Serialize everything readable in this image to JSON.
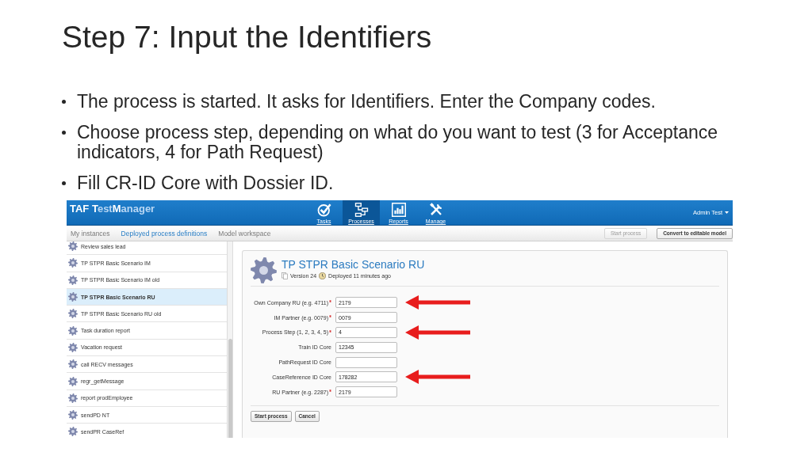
{
  "slide": {
    "title": "Step 7: Input the Identifiers",
    "bullets": [
      "The process is started. It asks for Identifiers. Enter the Company codes.",
      "Choose process step, depending on what do you want to test (3 for Acceptance indicators, 4 for Path Request)",
      "Fill CR-ID Core with Dossier ID."
    ]
  },
  "app": {
    "logo": {
      "segments": [
        {
          "text": "TAF T",
          "strong": true
        },
        {
          "text": "est",
          "strong": false
        },
        {
          "text": "M",
          "strong": true
        },
        {
          "text": "anager",
          "strong": false
        }
      ]
    },
    "nav": [
      {
        "label": "Tasks",
        "selected": false
      },
      {
        "label": "Processes",
        "selected": true
      },
      {
        "label": "Reports",
        "selected": false
      },
      {
        "label": "Manage",
        "selected": false
      }
    ],
    "user_menu": {
      "label": "Admin Test"
    },
    "tabs": [
      {
        "label": "My instances",
        "selected": false
      },
      {
        "label": "Deployed process definitions",
        "selected": true
      },
      {
        "label": "Model workspace",
        "selected": false
      }
    ],
    "toolbar_buttons": [
      {
        "label": "Start process",
        "disabled": true
      },
      {
        "label": "Convert to editable model",
        "disabled": false
      }
    ],
    "sidebar": {
      "items": [
        {
          "label": "Review sales lead",
          "selected": false
        },
        {
          "label": "TP STPR Basic Scenario IM",
          "selected": false
        },
        {
          "label": "TP STPR Basic Scenario IM old",
          "selected": false
        },
        {
          "label": "TP STPR Basic Scenario RU",
          "selected": true
        },
        {
          "label": "TP STPR Basic Scenario RU old",
          "selected": false
        },
        {
          "label": "Task duration report",
          "selected": false
        },
        {
          "label": "Vacation request",
          "selected": false
        },
        {
          "label": "call RECV messages",
          "selected": false
        },
        {
          "label": "regr_getMessage",
          "selected": false
        },
        {
          "label": "report prodEmployee",
          "selected": false
        },
        {
          "label": "sendPD NT",
          "selected": false
        },
        {
          "label": "sendPR CaseRef",
          "selected": false
        }
      ]
    },
    "process": {
      "title": "TP STPR Basic Scenario RU",
      "version": "Version 24",
      "deployed": "Deployed 11 minutes ago",
      "fields": [
        {
          "label": "Own Company RU (e.g. 4711)",
          "required": true,
          "value": "2179",
          "annotated": true
        },
        {
          "label": "IM Partner (e.g. 0079)",
          "required": true,
          "value": "0079",
          "annotated": false
        },
        {
          "label": "Process Step (1, 2, 3, 4, 5)",
          "required": true,
          "value": "4",
          "annotated": true
        },
        {
          "label": "Train ID Core",
          "required": false,
          "value": "12345",
          "annotated": false
        },
        {
          "label": "PathRequest ID Core",
          "required": false,
          "annotated": false
        },
        {
          "label": "CaseReference ID Core",
          "required": false,
          "value": "178282",
          "annotated": true
        },
        {
          "label": "RU Partner (e.g. 2287)",
          "required": true,
          "value": "2179",
          "annotated": false
        }
      ],
      "buttons": [
        "Start process",
        "Cancel"
      ]
    }
  }
}
